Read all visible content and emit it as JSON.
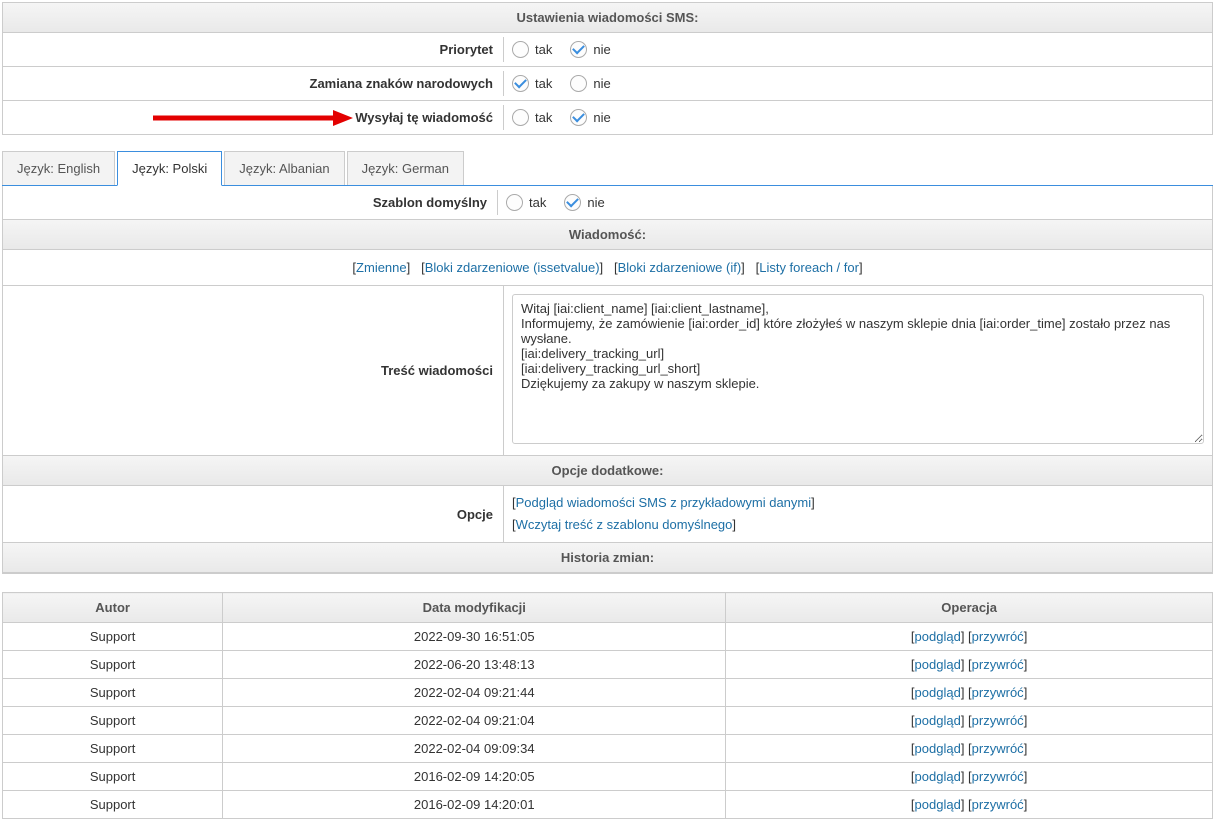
{
  "sms_settings": {
    "header": "Ustawienia wiadomości SMS:",
    "priority_label": "Priorytet",
    "priority_yes": "tak",
    "priority_no": "nie",
    "national_label": "Zamiana znaków narodowych",
    "national_yes": "tak",
    "national_no": "nie",
    "send_label": "Wysyłaj tę wiadomość",
    "send_yes": "tak",
    "send_no": "nie"
  },
  "tabs": {
    "english": "Język: English",
    "polski": "Język: Polski",
    "albanian": "Język: Albanian",
    "german": "Język: German"
  },
  "template": {
    "default_label": "Szablon domyślny",
    "default_yes": "tak",
    "default_no": "nie"
  },
  "message": {
    "header": "Wiadomość:",
    "links": {
      "zmienne": "Zmienne",
      "issetvalue": "Bloki zdarzeniowe (issetvalue)",
      "if": "Bloki zdarzeniowe (if)",
      "foreach": "Listy foreach / for"
    },
    "body_label": "Treść wiadomości",
    "body_value": "Witaj [iai:client_name] [iai:client_lastname],\nInformujemy, że zamówienie [iai:order_id] które złożyłeś w naszym sklepie dnia [iai:order_time] zostało przez nas wysłane.\n[iai:delivery_tracking_url]\n[iai:delivery_tracking_url_short]\nDziękujemy za zakupy w naszym sklepie."
  },
  "extra": {
    "header": "Opcje dodatkowe:",
    "label": "Opcje",
    "preview": "Podgląd wiadomości SMS z przykładowymi danymi",
    "load": "Wczytaj treść z szablonu domyślnego"
  },
  "history": {
    "header": "Historia zmian:",
    "col_author": "Autor",
    "col_date": "Data modyfikacji",
    "col_op": "Operacja",
    "op_preview": "podgląd",
    "op_restore": "przywróć",
    "rows": [
      {
        "author": "Support",
        "date": "2022-09-30 16:51:05"
      },
      {
        "author": "Support",
        "date": "2022-06-20 13:48:13"
      },
      {
        "author": "Support",
        "date": "2022-02-04 09:21:44"
      },
      {
        "author": "Support",
        "date": "2022-02-04 09:21:04"
      },
      {
        "author": "Support",
        "date": "2022-02-04 09:09:34"
      },
      {
        "author": "Support",
        "date": "2016-02-09 14:20:05"
      },
      {
        "author": "Support",
        "date": "2016-02-09 14:20:01"
      }
    ]
  }
}
